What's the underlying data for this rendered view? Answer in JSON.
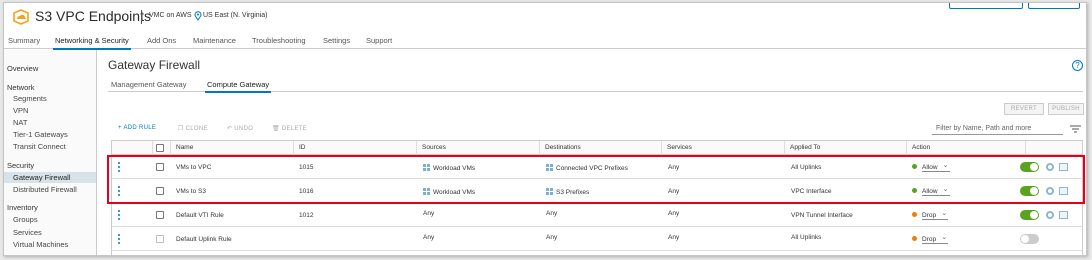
{
  "header": {
    "title": "S3 VPC Endpoints",
    "org": "VMC on AWS",
    "region": "US East (N. Virginia)",
    "accent_color": "#0079b8"
  },
  "tabs": [
    "Summary",
    "Networking & Security",
    "Add Ons",
    "Maintenance",
    "Troubleshooting",
    "Settings",
    "Support"
  ],
  "sidebar": {
    "overview": "Overview",
    "network_heading": "Network",
    "network_items": [
      "Segments",
      "VPN",
      "NAT",
      "Tier-1 Gateways",
      "Transit Connect"
    ],
    "security_heading": "Security",
    "security_items": [
      "Gateway Firewall",
      "Distributed Firewall"
    ],
    "inventory_heading": "Inventory",
    "inventory_items": [
      "Groups",
      "Services",
      "Virtual Machines"
    ]
  },
  "main": {
    "title": "Gateway Firewall",
    "subtabs": [
      "Management Gateway",
      "Compute Gateway"
    ],
    "revert_label": "REVERT",
    "publish_label": "PUBLISH",
    "toolbar": {
      "add_rule": "+ ADD RULE",
      "clone": "CLONE",
      "undo": "UNDO",
      "delete": "DELETE"
    },
    "filter_placeholder": "Filter by Name, Path and more"
  },
  "table": {
    "columns": [
      "Name",
      "ID",
      "Sources",
      "Destinations",
      "Services",
      "Applied To",
      "Action"
    ],
    "rows": [
      {
        "name": "VMs to VPC",
        "id": "1015",
        "sources": "Workload VMs",
        "destinations": "Connected VPC Prefixes",
        "services": "Any",
        "applied_to": "All Uplinks",
        "action": "Allow",
        "enabled": true
      },
      {
        "name": "VMs to S3",
        "id": "1016",
        "sources": "Workload VMs",
        "destinations": "S3 Prefixes",
        "services": "Any",
        "applied_to": "VPC Interface",
        "action": "Allow",
        "enabled": true
      },
      {
        "name": "Default VTI Rule",
        "id": "1012",
        "sources": "Any",
        "destinations": "Any",
        "services": "Any",
        "applied_to": "VPN Tunnel Interface",
        "action": "Drop",
        "enabled": true
      },
      {
        "name": "Default Uplink Rule",
        "id": "",
        "sources": "Any",
        "destinations": "Any",
        "services": "Any",
        "applied_to": "All Uplinks",
        "action": "Drop",
        "enabled": false
      }
    ],
    "allow_color": "#5aa220",
    "drop_color": "#f57c00"
  }
}
